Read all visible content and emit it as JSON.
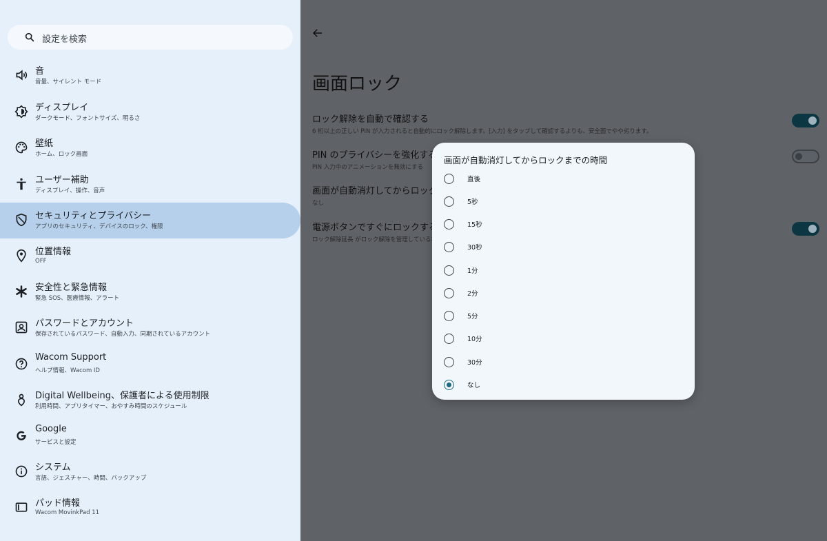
{
  "search": {
    "placeholder": "設定を検索"
  },
  "sidebar": {
    "items": [
      {
        "title": "音",
        "subtitle": "音量、サイレント モード",
        "icon": "volume-icon"
      },
      {
        "title": "ディスプレイ",
        "subtitle": "ダークモード、フォントサイズ、明るさ",
        "icon": "brightness-icon"
      },
      {
        "title": "壁紙",
        "subtitle": "ホーム、ロック画面",
        "icon": "palette-icon"
      },
      {
        "title": "ユーザー補助",
        "subtitle": "ディスプレイ、操作、音声",
        "icon": "accessibility-icon"
      },
      {
        "title": "セキュリティとプライバシー",
        "subtitle": "アプリのセキュリティ、デバイスのロック、権限",
        "icon": "shield-icon",
        "selected": true
      },
      {
        "title": "位置情報",
        "subtitle": "OFF",
        "icon": "location-icon"
      },
      {
        "title": "安全性と緊急情報",
        "subtitle": "緊急 SOS、医療情報、アラート",
        "icon": "asterisk-icon"
      },
      {
        "title": "パスワードとアカウント",
        "subtitle": "保存されているパスワード、自動入力、同期されているアカウント",
        "icon": "account-box-icon"
      },
      {
        "title": "Wacom Support",
        "subtitle": "ヘルプ情報、Wacom ID",
        "icon": "help-icon"
      },
      {
        "title": "Digital Wellbeing、保護者による使用制限",
        "subtitle": "利用時間、アプリタイマー、おやすみ時間のスケジュール",
        "icon": "wellbeing-icon"
      },
      {
        "title": "Google",
        "subtitle": "サービスと設定",
        "icon": "google-icon"
      },
      {
        "title": "システム",
        "subtitle": "言語、ジェスチャー、時間、バックアップ",
        "icon": "info-icon"
      },
      {
        "title": "パッド情報",
        "subtitle": "Wacom MovinkPad 11",
        "icon": "tablet-icon"
      }
    ]
  },
  "main": {
    "title": "画面ロック",
    "prefs": [
      {
        "title": "ロック解除を自動で確認する",
        "subtitle": "6 桁以上の正しい PIN が入力されると自動的にロック解除します。[入力] をタップして確認するよりも、安全面でやや劣ります。",
        "toggle": "on"
      },
      {
        "title": "PIN のプライバシーを強化する",
        "subtitle": "PIN 入力中のアニメーションを無効にする",
        "toggle": "off"
      },
      {
        "title": "画面が自動消灯してからロックまでの時間",
        "subtitle": "なし"
      },
      {
        "title": "電源ボタンですぐにロックする",
        "subtitle": "ロック解除延長 がロック解除を管理している場合を除く",
        "toggle": "on"
      }
    ]
  },
  "dialog": {
    "title": "画面が自動消灯してからロックまでの時間",
    "options": [
      "直後",
      "5秒",
      "15秒",
      "30秒",
      "1分",
      "2分",
      "5分",
      "10分",
      "30分",
      "なし"
    ],
    "selected": "なし"
  },
  "colors": {
    "accent": "#1f6a80",
    "sidebar_bg": "#e6f0fa",
    "selected_bg": "#b6cfea",
    "scrim": "#5f6368"
  }
}
